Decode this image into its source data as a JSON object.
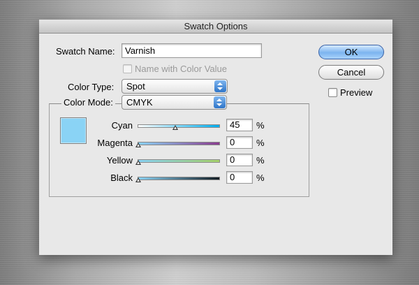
{
  "dialog": {
    "title": "Swatch Options",
    "swatch_name_label": "Swatch Name:",
    "swatch_name_value": "Varnish",
    "name_with_color_label": "Name with Color Value",
    "name_with_color_enabled": false,
    "color_type_label": "Color Type:",
    "color_type_value": "Spot",
    "color_mode_label": "Color Mode:",
    "color_mode_value": "CMYK",
    "preview_label": "Preview",
    "preview_checked": false,
    "ok_label": "OK",
    "cancel_label": "Cancel",
    "swatch_color": "#8ad3f5"
  },
  "sliders": [
    {
      "name": "Cyan",
      "value": "45",
      "unit": "%",
      "fraction": 0.45,
      "gradient": [
        "#ffffff",
        "#00aeef"
      ]
    },
    {
      "name": "Magenta",
      "value": "0",
      "unit": "%",
      "fraction": 0.0,
      "gradient": [
        "#8ad3f5",
        "#8a3b8f"
      ]
    },
    {
      "name": "Yellow",
      "value": "0",
      "unit": "%",
      "fraction": 0.0,
      "gradient": [
        "#8ad3f5",
        "#a6d26a"
      ]
    },
    {
      "name": "Black",
      "value": "0",
      "unit": "%",
      "fraction": 0.0,
      "gradient": [
        "#8ad3f5",
        "#111b22"
      ]
    }
  ]
}
